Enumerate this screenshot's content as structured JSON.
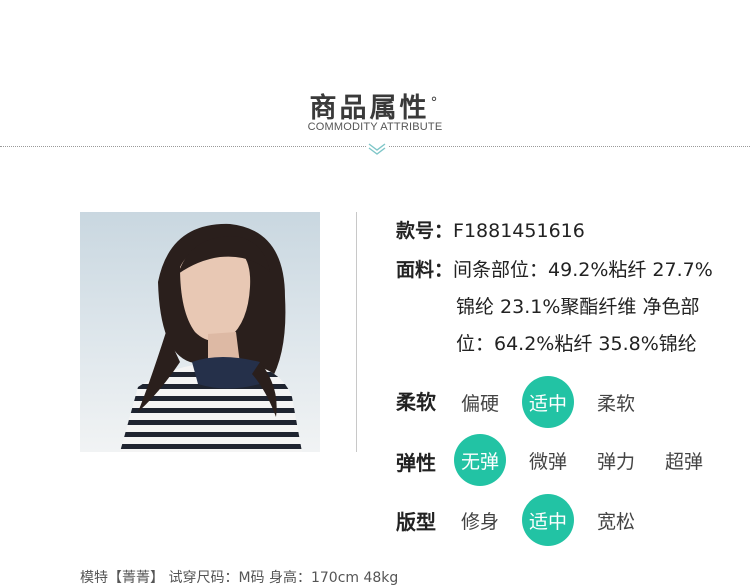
{
  "header": {
    "title": "商品属性",
    "title_mark": "°",
    "subtitle": "COMMODITY ATTRIBUTE"
  },
  "info": {
    "style_label": "款号：",
    "style_value": "F1881451616",
    "fabric_label": "面料：",
    "fabric_line1": "间条部位：49.2%粘纤 27.7%",
    "fabric_line2": "锦纶 23.1%聚酯纤维 净色部",
    "fabric_line3": "位：64.2%粘纤 35.8%锦纶"
  },
  "attributes": {
    "softness": {
      "label": "柔软",
      "options": [
        "偏硬",
        "适中",
        "柔软"
      ],
      "selected": "适中"
    },
    "elasticity": {
      "label": "弹性",
      "options": [
        "无弹",
        "微弹",
        "弹力",
        "超弹"
      ],
      "selected": "无弹"
    },
    "fit": {
      "label": "版型",
      "options": [
        "修身",
        "适中",
        "宽松"
      ],
      "selected": "适中"
    }
  },
  "footer": {
    "model_info": "模特【菁菁】 试穿尺码：M码 身高：170cm 48kg"
  },
  "colors": {
    "accent": "#22c3a4"
  }
}
